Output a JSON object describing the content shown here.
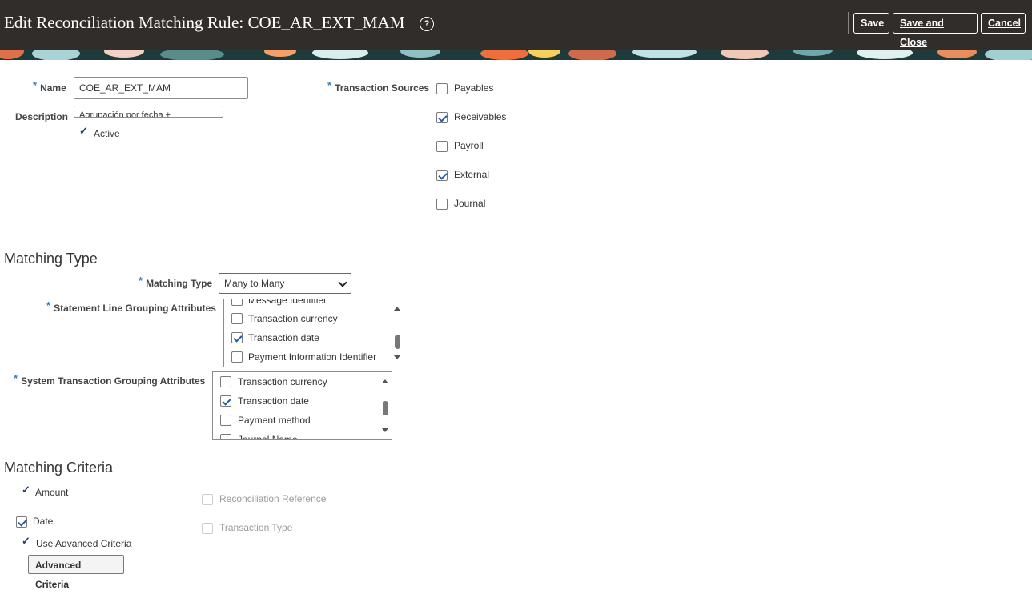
{
  "header": {
    "title": "Edit Reconciliation Matching Rule: COE_AR_EXT_MAM",
    "help_icon": "?",
    "save": "Save",
    "save_close": "Save and Close",
    "cancel": "Cancel"
  },
  "form": {
    "required_marker": "*",
    "name_label": "Name",
    "name_value": "COE_AR_EXT_MAM",
    "description_label": "Description",
    "description_value": "Agrupación por fecha +",
    "active_label": "Active",
    "check_mark": "✓",
    "transaction_sources_label": "Transaction Sources",
    "transaction_sources": [
      {
        "label": "Payables",
        "checked": false
      },
      {
        "label": "Receivables",
        "checked": true
      },
      {
        "label": "Payroll",
        "checked": false
      },
      {
        "label": "External",
        "checked": true
      },
      {
        "label": "Journal",
        "checked": false
      }
    ]
  },
  "matching_type": {
    "heading": "Matching Type",
    "type_label": "Matching Type",
    "type_value": "Many to Many",
    "statement_label": "Statement Line Grouping Attributes",
    "statement_items": [
      {
        "label": "Message Identifier",
        "checked": false
      },
      {
        "label": "Transaction currency",
        "checked": false
      },
      {
        "label": "Transaction date",
        "checked": true
      },
      {
        "label": "Payment Information Identifier",
        "checked": false
      }
    ],
    "system_label": "System Transaction Grouping Attributes",
    "system_items": [
      {
        "label": "Transaction currency",
        "checked": false
      },
      {
        "label": "Transaction date",
        "checked": true
      },
      {
        "label": "Payment method",
        "checked": false
      },
      {
        "label": "Journal Name",
        "checked": false
      }
    ]
  },
  "matching_criteria": {
    "heading": "Matching Criteria",
    "amount": "Amount",
    "date": "Date",
    "use_advanced": "Use Advanced Criteria",
    "advanced_button": "Advanced Criteria",
    "reconciliation_reference": "Reconciliation Reference",
    "transaction_type": "Transaction Type"
  },
  "colors": {
    "header_bg": "#312d2a",
    "accent": "#1f5fa8"
  }
}
